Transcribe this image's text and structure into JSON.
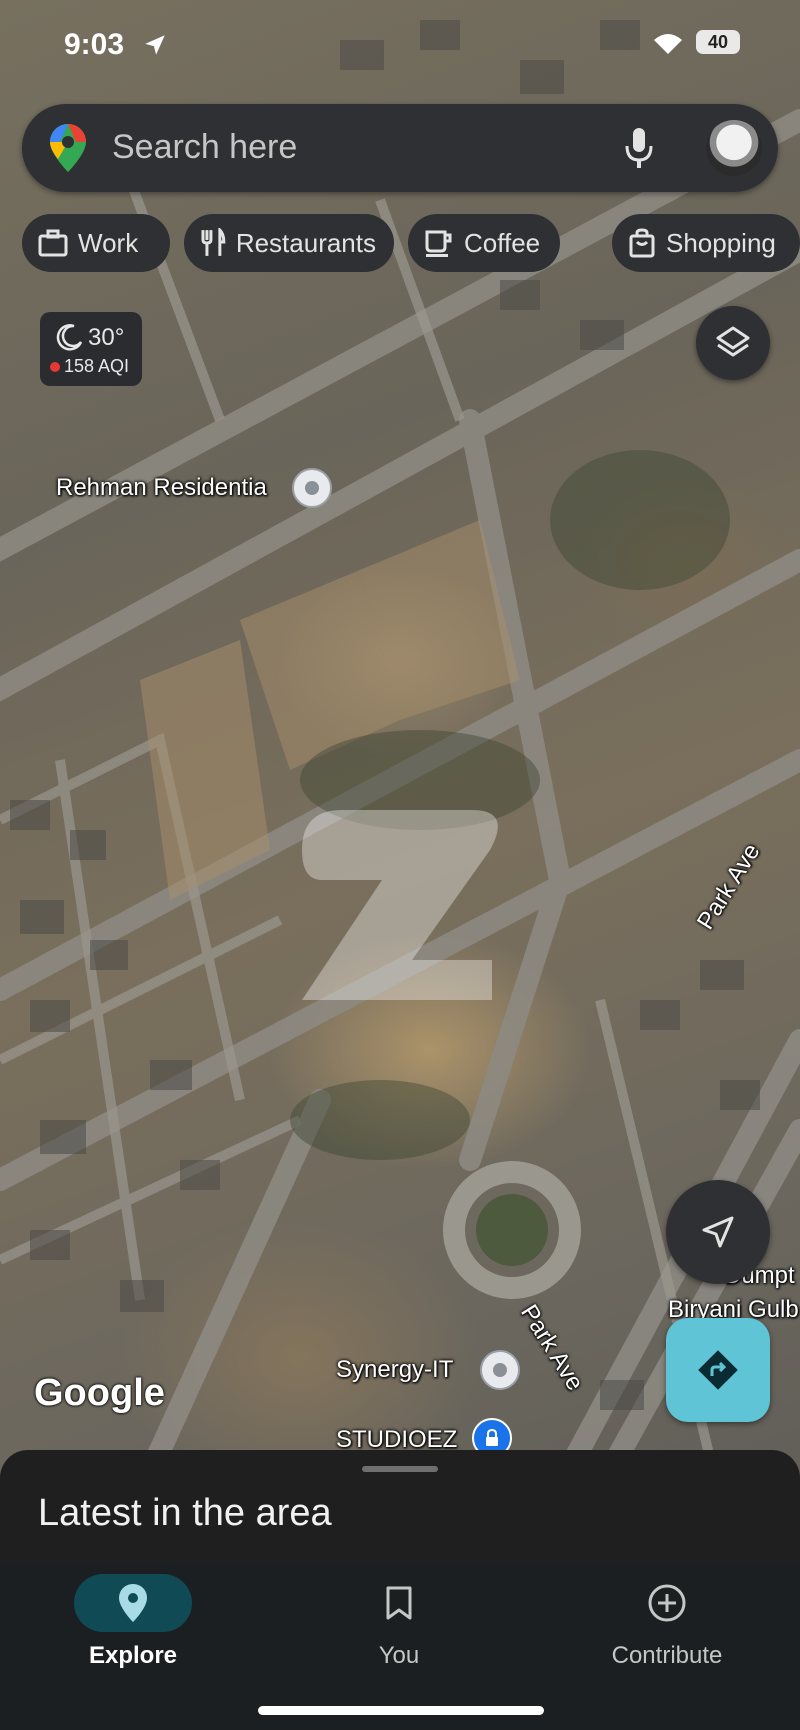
{
  "status_bar": {
    "time": "9:03",
    "battery": "40"
  },
  "search": {
    "placeholder": "Search here"
  },
  "chips": [
    {
      "label": "Work",
      "icon": "briefcase-icon"
    },
    {
      "label": "Restaurants",
      "icon": "fork-knife-icon"
    },
    {
      "label": "Coffee",
      "icon": "coffee-cup-icon"
    },
    {
      "label": "Shopping",
      "icon": "shopping-bag-icon"
    }
  ],
  "weather": {
    "temperature": "30°",
    "aqi": "158 AQI",
    "aqi_color": "#e53935"
  },
  "map_labels": {
    "rehman": "Rehman Residentia",
    "park_ave_1": "Park Ave",
    "park_ave_2": "Park Ave",
    "synergy": "Synergy-IT",
    "studioez": "STUDIOEZ",
    "dumpt": "Dumpt",
    "biryani": "Biryani Gulb"
  },
  "map_attribution": "Google",
  "bottom_sheet": {
    "title": "Latest in the area"
  },
  "nav": [
    {
      "label": "Explore",
      "icon": "location-pin-icon",
      "active": true
    },
    {
      "label": "You",
      "icon": "bookmark-icon",
      "active": false
    },
    {
      "label": "Contribute",
      "icon": "add-circle-icon",
      "active": false
    }
  ],
  "colors": {
    "accent": "#5fc4d6",
    "active_nav_bg": "#0f4a55",
    "surface": "#2f3033"
  }
}
